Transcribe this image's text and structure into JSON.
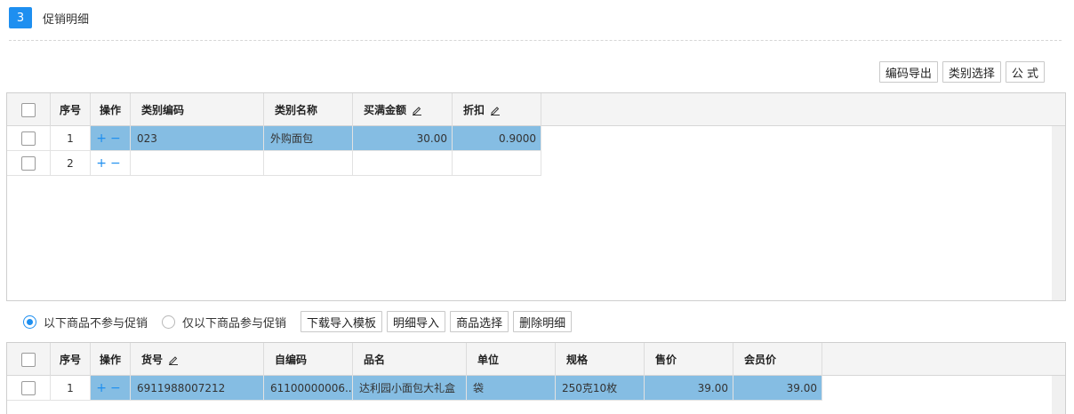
{
  "section": {
    "step": "3",
    "title": "促销明细"
  },
  "toolbar_top": {
    "export_code": "编码导出",
    "select_category": "类别选择",
    "formula": "公 式"
  },
  "category_table": {
    "headers": {
      "seq": "序号",
      "op": "操作",
      "code": "类别编码",
      "name": "类别名称",
      "amount": "买满金额",
      "discount": "折扣"
    },
    "rows": [
      {
        "seq": "1",
        "code": "023",
        "name": "外购面包",
        "amount": "30.00",
        "discount": "0.9000"
      },
      {
        "seq": "2",
        "code": "",
        "name": "",
        "amount": "",
        "discount": ""
      }
    ]
  },
  "promo_scope": {
    "options": [
      {
        "label": "以下商品不参与促销",
        "checked": true
      },
      {
        "label": "仅以下商品参与促销",
        "checked": false
      }
    ],
    "buttons": {
      "download_template": "下载导入模板",
      "import_detail": "明细导入",
      "select_goods": "商品选择",
      "delete_detail": "删除明细"
    }
  },
  "goods_table": {
    "headers": {
      "seq": "序号",
      "op": "操作",
      "sku": "货号",
      "selfcode": "自编码",
      "name": "品名",
      "unit": "单位",
      "spec": "规格",
      "price": "售价",
      "member_price": "会员价"
    },
    "rows": [
      {
        "seq": "1",
        "sku": "6911988007212",
        "selfcode": "61100000006...",
        "name": "达利园小面包大礼盒",
        "unit": "袋",
        "spec": "250克10枚",
        "price": "39.00",
        "member_price": "39.00"
      }
    ]
  },
  "icons": {
    "edit": "pencil-icon",
    "add": "plus-icon",
    "remove": "minus-icon"
  },
  "colors": {
    "accent": "#1e8ff0",
    "selected_row": "#85bde3"
  }
}
